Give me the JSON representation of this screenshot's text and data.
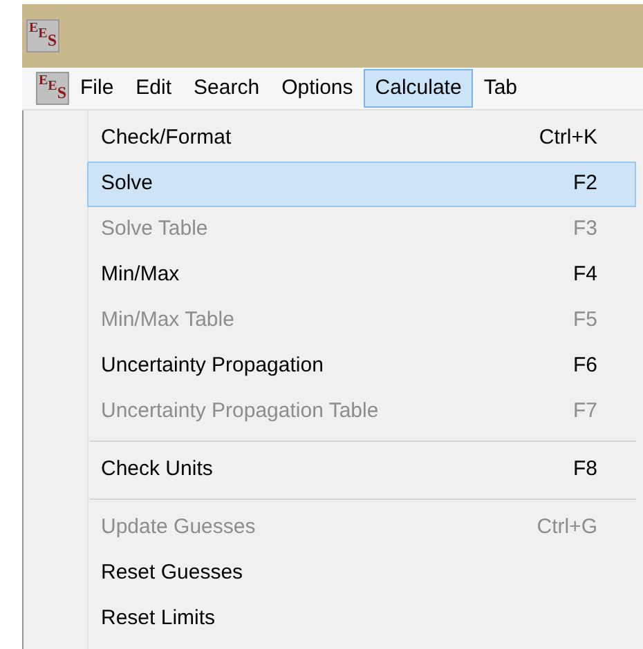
{
  "window": {
    "icon_text": "EES"
  },
  "menu_bar": {
    "icon_text": "EES",
    "items": [
      {
        "label": "File",
        "selected": false
      },
      {
        "label": "Edit",
        "selected": false
      },
      {
        "label": "Search",
        "selected": false
      },
      {
        "label": "Options",
        "selected": false
      },
      {
        "label": "Calculate",
        "selected": true
      },
      {
        "label": "Tab",
        "selected": false
      }
    ]
  },
  "dropdown": {
    "items": [
      {
        "kind": "item",
        "label": "Check/Format",
        "shortcut": "Ctrl+K",
        "disabled": false,
        "selected": false
      },
      {
        "kind": "item",
        "label": "Solve",
        "shortcut": "F2",
        "disabled": false,
        "selected": true
      },
      {
        "kind": "item",
        "label": "Solve Table",
        "shortcut": "F3",
        "disabled": true,
        "selected": false
      },
      {
        "kind": "item",
        "label": "Min/Max",
        "shortcut": "F4",
        "disabled": false,
        "selected": false
      },
      {
        "kind": "item",
        "label": "Min/Max Table",
        "shortcut": "F5",
        "disabled": true,
        "selected": false
      },
      {
        "kind": "item",
        "label": "Uncertainty Propagation",
        "shortcut": "F6",
        "disabled": false,
        "selected": false
      },
      {
        "kind": "item",
        "label": "Uncertainty Propagation Table",
        "shortcut": "F7",
        "disabled": true,
        "selected": false
      },
      {
        "kind": "separator"
      },
      {
        "kind": "item",
        "label": "Check Units",
        "shortcut": "F8",
        "disabled": false,
        "selected": false
      },
      {
        "kind": "separator"
      },
      {
        "kind": "item",
        "label": "Update Guesses",
        "shortcut": "Ctrl+G",
        "disabled": true,
        "selected": false
      },
      {
        "kind": "item",
        "label": "Reset Guesses",
        "disabled": false,
        "selected": false
      },
      {
        "kind": "item",
        "label": "Reset Limits",
        "disabled": false,
        "selected": false
      }
    ]
  }
}
